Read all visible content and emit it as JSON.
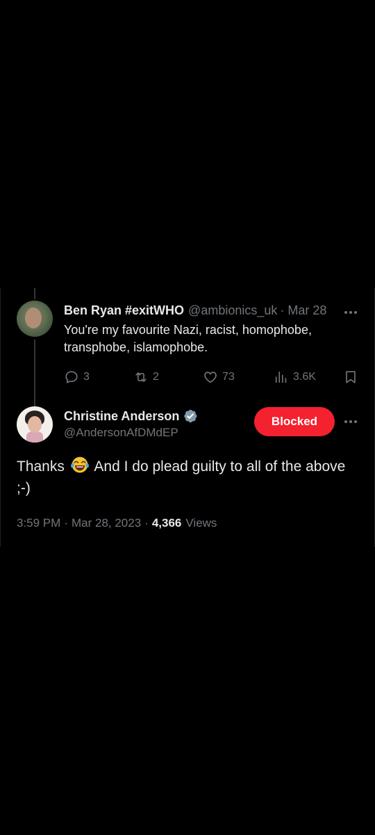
{
  "reply_tweet": {
    "author_name": "Ben Ryan #exitWHO",
    "author_handle": "@ambionics_uk",
    "separator": "·",
    "date": "Mar 28",
    "text": "You're my favourite Nazi, racist, homophobe, transphobe, islamophobe.",
    "stats": {
      "replies": "3",
      "retweets": "2",
      "likes": "73",
      "views": "3.6K"
    },
    "icons": {
      "more": "more-horizontal-icon",
      "reply": "reply-bubble-icon",
      "retweet": "retweet-icon",
      "like": "heart-icon",
      "views": "views-chart-icon",
      "bookmark": "bookmark-icon"
    }
  },
  "main_tweet": {
    "author_name": "Christine Anderson",
    "author_handle": "@AndersonAfDMdEP",
    "verified_icon": "verified-badge-icon",
    "blocked_label": "Blocked",
    "text_before_emoji": "Thanks",
    "emoji": "face-with-tears-of-joy-emoji",
    "text_after_emoji": "And I do plead guilty to all of the above ;-)",
    "time": "3:59 PM",
    "separator": "·",
    "date": "Mar 28, 2023",
    "views_count": "4,366",
    "views_label": "Views"
  },
  "colors": {
    "background": "#000000",
    "primary_text": "#e7e9ea",
    "secondary_text": "#71767b",
    "blocked_red": "#f4212e",
    "verified_badge": "#829aab",
    "thread_line": "#333639"
  }
}
